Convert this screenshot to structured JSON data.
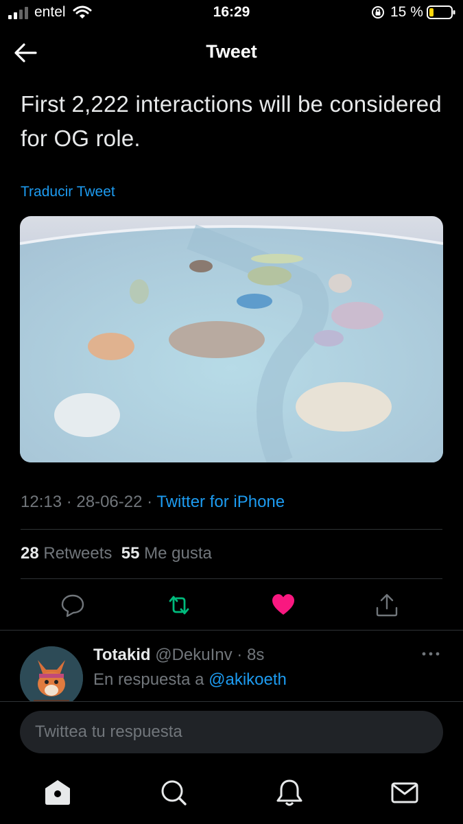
{
  "status_bar": {
    "carrier": "entel",
    "time": "16:29",
    "battery": "15 %"
  },
  "header": {
    "title": "Tweet"
  },
  "tweet": {
    "text": "First 2,222 interactions will be considered for OG role.",
    "translate_label": "Traducir Tweet",
    "time": "12:13",
    "date": "28-06-22",
    "source": "Twitter for iPhone",
    "retweets_count": "28",
    "retweets_label": "Retweets",
    "likes_count": "55",
    "likes_label": "Me gusta"
  },
  "actions": [
    "reply-icon",
    "retweet-icon",
    "like-icon",
    "share-icon"
  ],
  "reply": {
    "name": "Totakid",
    "handle": "@DekuInv",
    "age": "8s",
    "replying_to_label": "En respuesta a",
    "replying_to": "@akikoeth"
  },
  "composer": {
    "placeholder": "Twittea tu respuesta"
  },
  "bottom_nav": [
    "home-icon",
    "search-icon",
    "notifications-icon",
    "messages-icon"
  ],
  "colors": {
    "accent": "#1d9bf0",
    "retweet": "#00ba7c",
    "like": "#f91880",
    "background": "#000000"
  }
}
